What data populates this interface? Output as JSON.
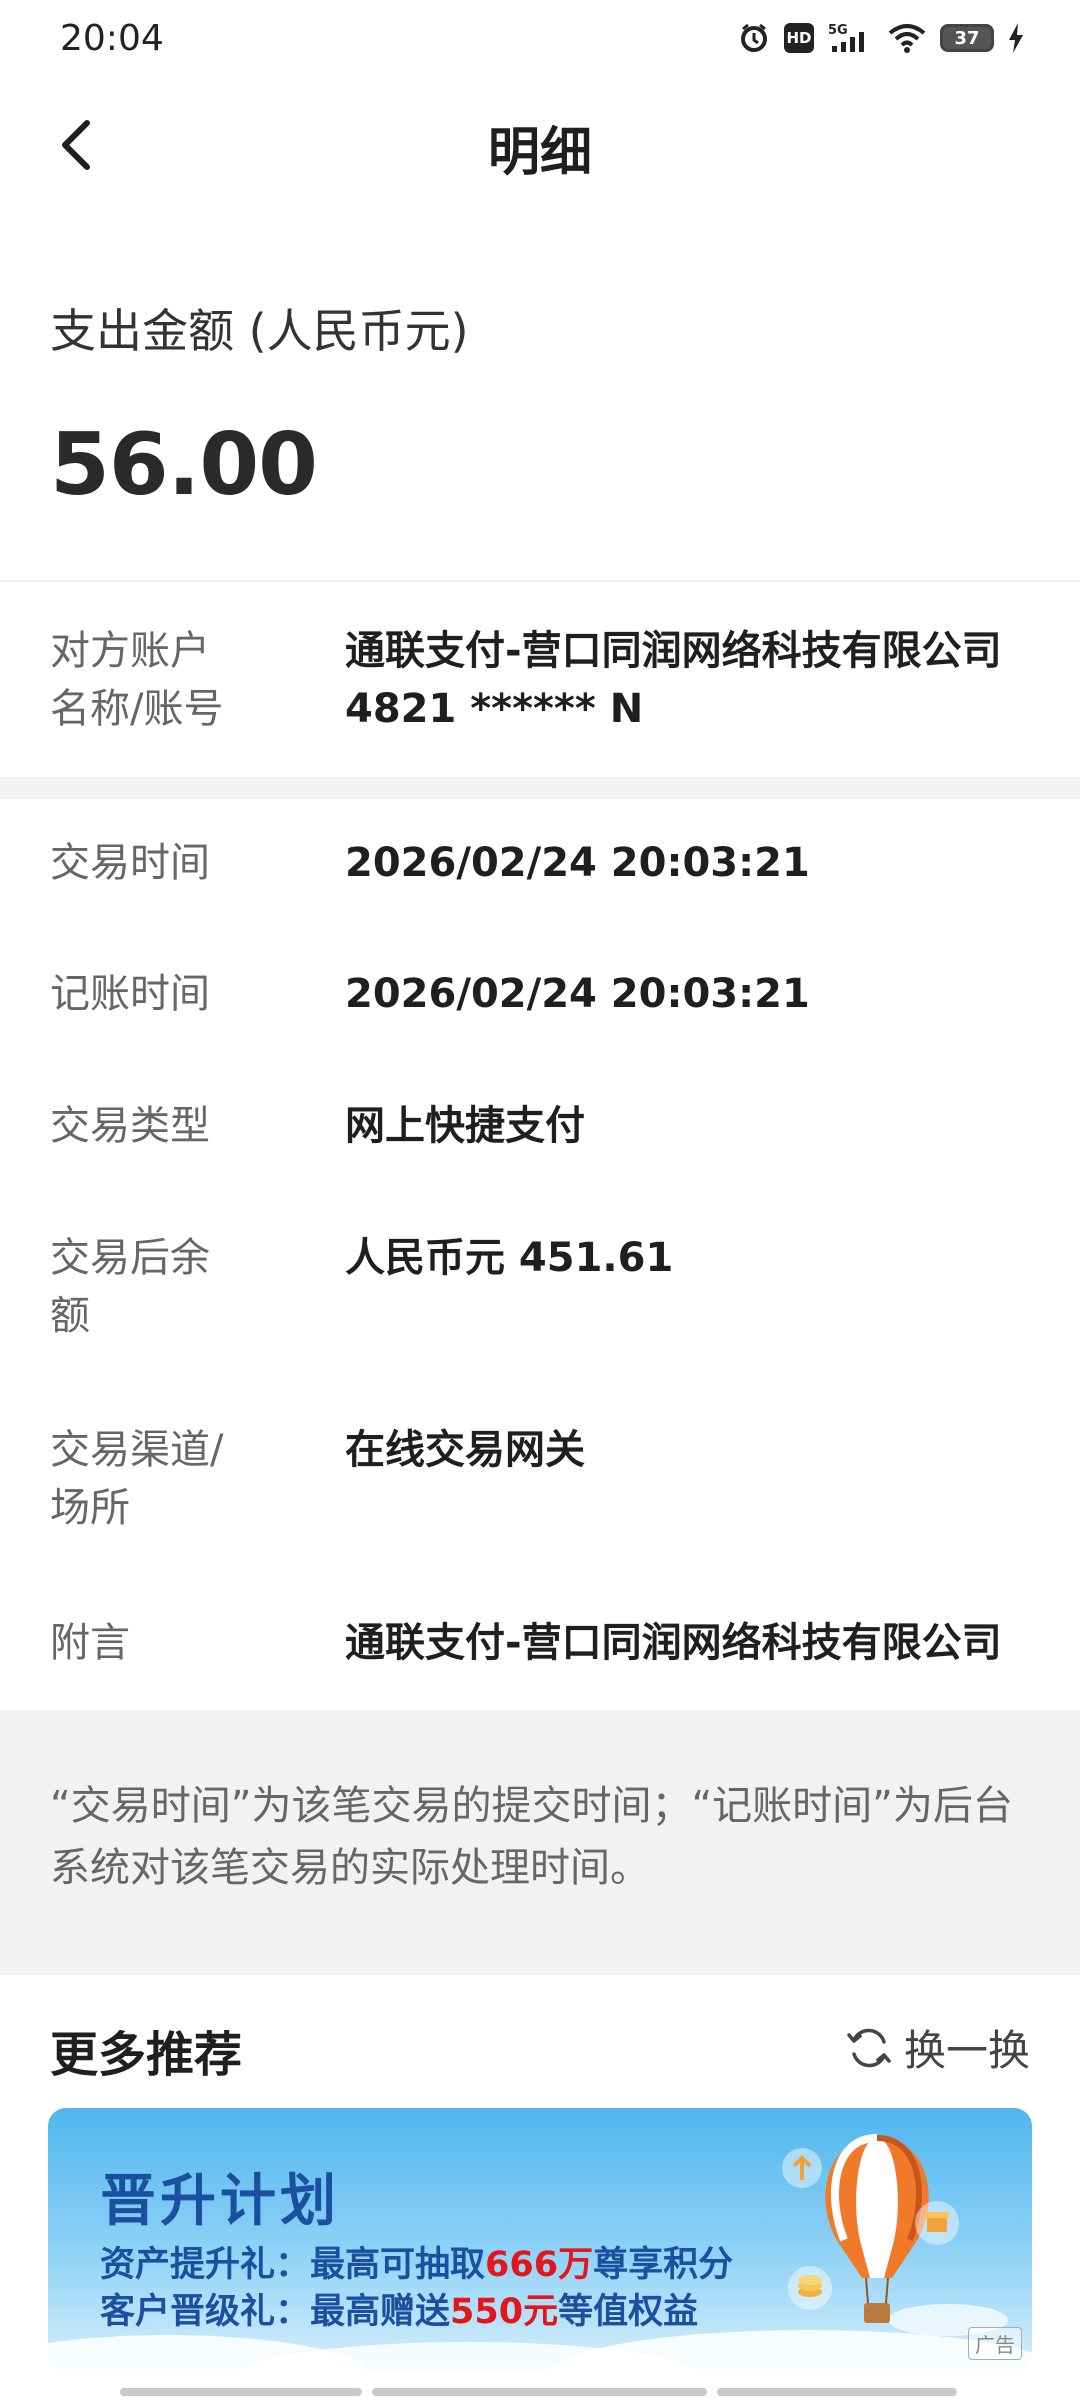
{
  "status_bar": {
    "time": "20:04",
    "signal_label": "5G",
    "hd_label": "HD",
    "battery_level": "37"
  },
  "nav": {
    "title": "明细"
  },
  "amount": {
    "label": "支出金额 (人民币元)",
    "value": "56.00"
  },
  "counterparty": {
    "label_line1": "对方账户",
    "label_line2": "名称/账号",
    "name": "通联支付-营口同润网络科技有限公司",
    "account": "4821 ****** N"
  },
  "details": [
    {
      "label": "交易时间",
      "value": "2026/02/24 20:03:21"
    },
    {
      "label": "记账时间",
      "value": "2026/02/24 20:03:21"
    },
    {
      "label": "交易类型",
      "value": "网上快捷支付"
    },
    {
      "label_line1": "交易后余",
      "label_line2": "额",
      "value": "人民币元 451.61"
    },
    {
      "label_line1": "交易渠道/",
      "label_line2": "场所",
      "value": "在线交易网关"
    },
    {
      "label": "附言",
      "value": "通联支付-营口同润网络科技有限公司"
    }
  ],
  "note": "“交易时间”为该笔交易的提交时间；“记账时间”为后台系统对该笔交易的实际处理时间。",
  "recommend": {
    "title": "更多推荐",
    "refresh_label": "换一换",
    "banner": {
      "title": "晋升计划",
      "line1_prefix": "资产提升礼：最高可抽取",
      "line1_highlight": "666万",
      "line1_suffix": "尊享积分",
      "line2_prefix": "客户晋级礼：最高赠送",
      "line2_highlight": "550元",
      "line2_suffix": "等值权益",
      "ad_label": "广告"
    }
  },
  "colors": {
    "highlight_red": "#e4161b",
    "banner_text_blue": "#1b4fa0",
    "label_gray": "#666666",
    "divider_gray": "#f2f2f2"
  },
  "icons": [
    "alarm-icon",
    "hd-icon",
    "signal-5g-icon",
    "wifi-icon",
    "battery-icon",
    "charging-icon",
    "back-arrow-icon",
    "refresh-icon",
    "balloon-illustration"
  ]
}
